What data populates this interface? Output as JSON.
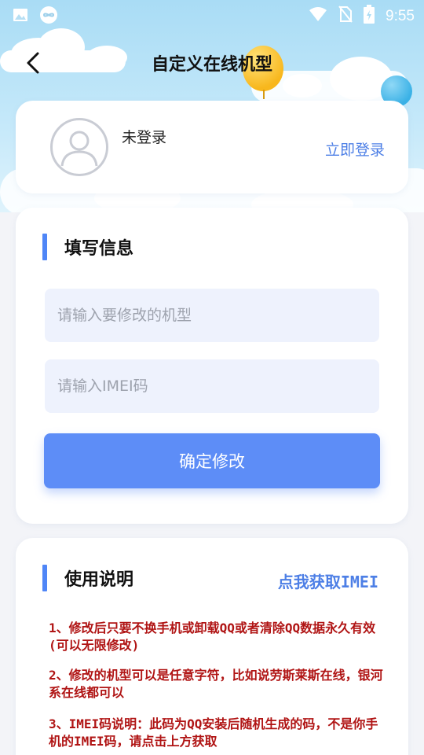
{
  "status_bar": {
    "time": "9:55",
    "left_icons": [
      "image-icon",
      "infinity-app-icon"
    ],
    "right_icons": [
      "wifi-icon",
      "no-sim-icon",
      "battery-charging-icon"
    ]
  },
  "header": {
    "title": "自定义在线机型",
    "back_icon": "chevron-left-icon"
  },
  "profile": {
    "status": "未登录",
    "login_label": "立即登录",
    "avatar_icon": "user-avatar-icon"
  },
  "form": {
    "section_title": "填写信息",
    "model_placeholder": "请输入要修改的机型",
    "imei_placeholder": "请输入IMEI码",
    "submit_label": "确定修改"
  },
  "help": {
    "section_title": "使用说明",
    "get_imei_label": "点我获取IMEI",
    "items": [
      "1、修改后只要不换手机或卸载QQ或者清除QQ数据永久有效(可以无限修改)",
      "2、修改的机型可以是任意字符，比如说劳斯莱斯在线，银河系在线都可以",
      "3、IMEI码说明：此码为QQ安装后随机生成的码，不是你手机的IMEI码，请点击上方获取"
    ]
  },
  "colors": {
    "accent": "#4f86f7",
    "button": "#5d8df7",
    "link": "#4d7fe6",
    "warning_text": "#b01414",
    "sky": "#a9dcf5",
    "input_bg": "#eef2fd"
  }
}
